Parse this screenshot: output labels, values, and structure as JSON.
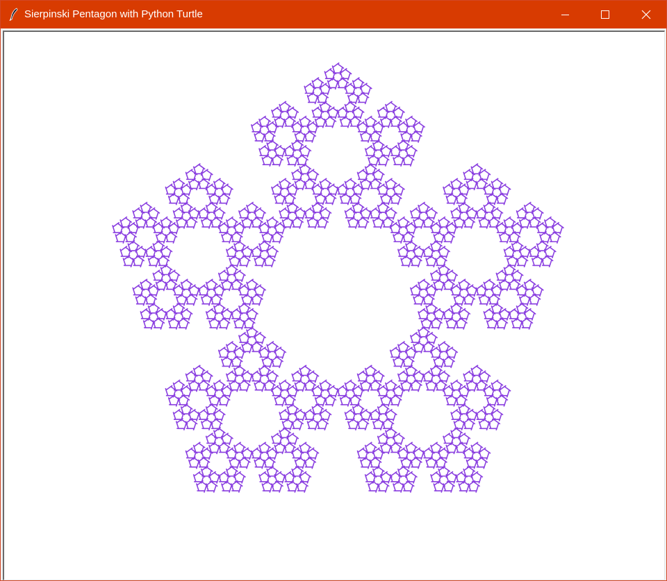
{
  "window": {
    "title": "Sierpinski Pentagon with Python Turtle",
    "titlebar_color": "#d83b01",
    "icon": "feather-icon"
  },
  "controls": {
    "minimize_icon": "minimize-icon",
    "maximize_icon": "maximize-icon",
    "close_icon": "close-icon"
  },
  "canvas": {
    "background": "#ffffff",
    "fractal": {
      "shape": "sierpinski-pentagon",
      "color": "#8a3fe0",
      "visible_depth": 4
    }
  }
}
